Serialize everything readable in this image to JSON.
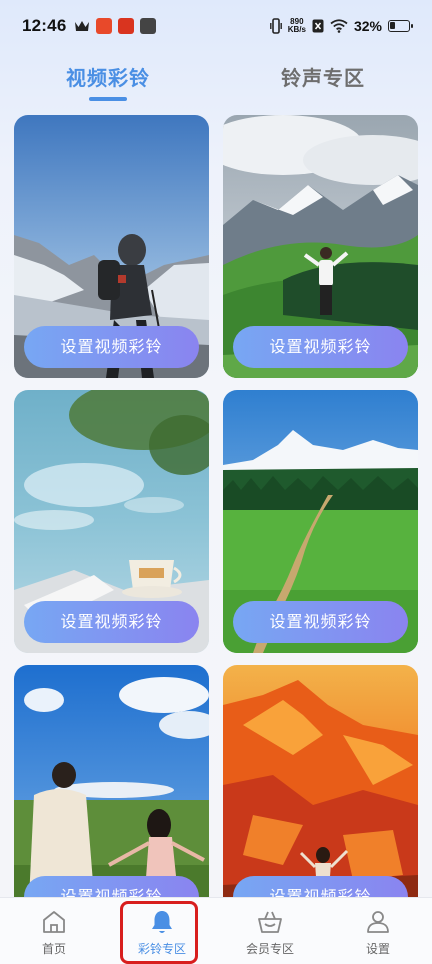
{
  "status_bar": {
    "time": "12:46",
    "net_speed_value": "890",
    "net_speed_unit": "KB/s",
    "battery_percent": "32%",
    "battery_level": 0.32
  },
  "tabs": [
    {
      "label": "视频彩铃",
      "active": true
    },
    {
      "label": "铃声专区",
      "active": false
    }
  ],
  "cards": [
    {
      "button_label": "设置视频彩铃",
      "scene": "hiker-snow-mountain"
    },
    {
      "button_label": "设置视频彩铃",
      "scene": "man-on-green-mountain"
    },
    {
      "button_label": "设置视频彩铃",
      "scene": "lake-teacup"
    },
    {
      "button_label": "设置视频彩铃",
      "scene": "grassland-path-snow-peak"
    },
    {
      "button_label": "设置视频彩铃",
      "scene": "couple-running-grassland"
    },
    {
      "button_label": "设置视频彩铃",
      "scene": "orange-mountain-person"
    }
  ],
  "bottom_nav": [
    {
      "label": "首页",
      "icon": "home-icon",
      "active": false
    },
    {
      "label": "彩铃专区",
      "icon": "bell-icon",
      "active": true
    },
    {
      "label": "会员专区",
      "icon": "basket-icon",
      "active": false
    },
    {
      "label": "设置",
      "icon": "user-icon",
      "active": false
    }
  ],
  "colors": {
    "accent": "#4a8fe4",
    "button_gradient_start": "#77a7f3",
    "button_gradient_end": "#8a84f0",
    "highlight": "#d81e1e"
  }
}
